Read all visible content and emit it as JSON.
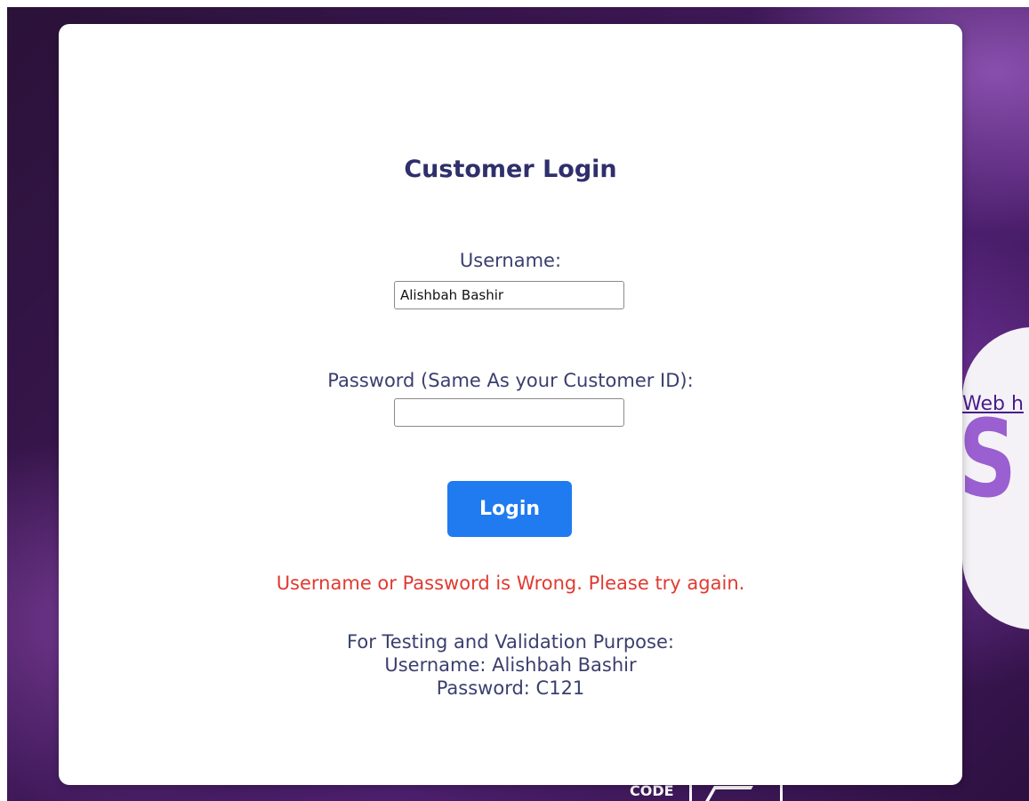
{
  "background": {
    "link_text": "Web h",
    "big_letter": "S",
    "bottom_text": "CODE"
  },
  "login": {
    "title": "Customer Login",
    "username_label": "Username:",
    "username_value": "Alishbah Bashir",
    "password_label": "Password (Same As your Customer ID):",
    "password_value": "",
    "login_button": "Login",
    "error_message": "Username or Password is Wrong. Please try again.",
    "test_info": {
      "heading": "For Testing and Validation Purpose:",
      "username_line": "Username: Alishbah Bashir",
      "password_line": "Password: C121"
    }
  },
  "colors": {
    "accent": "#1f7bef",
    "error": "#e03a31",
    "title": "#2f2f6b"
  }
}
